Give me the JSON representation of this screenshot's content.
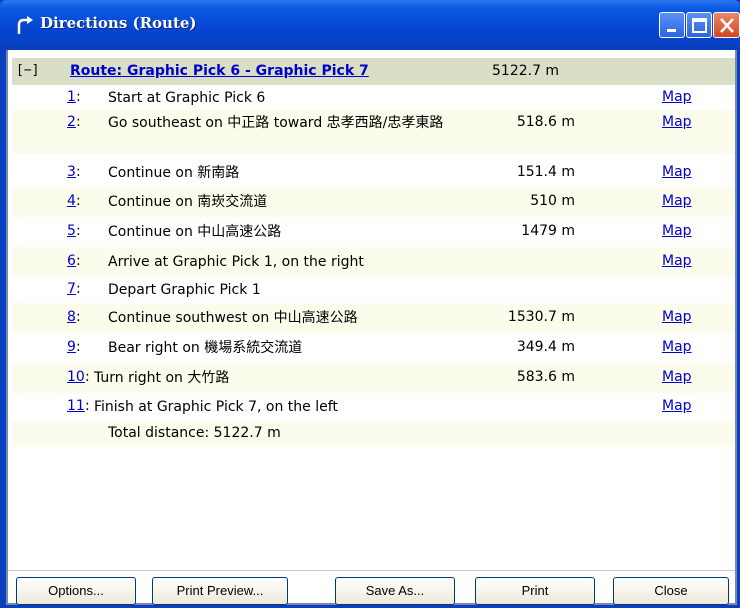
{
  "window": {
    "title": "Directions (Route)"
  },
  "route": {
    "toggle": "[−]",
    "name": "Route: Graphic Pick 6 - Graphic Pick 7",
    "distance": "5122.7 m"
  },
  "steps": [
    {
      "num": "1",
      "desc": "Start at Graphic Pick 6",
      "dist": "",
      "map": "Map"
    },
    {
      "num": "2",
      "desc": "Go southeast on 中正路 toward 忠孝西路/忠孝東路",
      "dist": "518.6 m",
      "map": "Map"
    },
    {
      "num": "3",
      "desc": "Continue on 新南路",
      "dist": "151.4 m",
      "map": "Map"
    },
    {
      "num": "4",
      "desc": "Continue on 南崁交流道",
      "dist": "510 m",
      "map": "Map"
    },
    {
      "num": "5",
      "desc": "Continue on 中山高速公路",
      "dist": "1479 m",
      "map": "Map"
    },
    {
      "num": "6",
      "desc": "Arrive at Graphic Pick 1, on the right",
      "dist": "",
      "map": "Map"
    },
    {
      "num": "7",
      "desc": "Depart Graphic Pick 1",
      "dist": "",
      "map": ""
    },
    {
      "num": "8",
      "desc": "Continue southwest on 中山高速公路",
      "dist": "1530.7 m",
      "map": "Map"
    },
    {
      "num": "9",
      "desc": "Bear right on 機場系統交流道",
      "dist": "349.4 m",
      "map": "Map"
    },
    {
      "num": "10",
      "desc": "Turn right on 大竹路",
      "dist": "583.6 m",
      "map": "Map"
    },
    {
      "num": "11",
      "desc": "Finish at Graphic Pick 7, on the left",
      "dist": "",
      "map": "Map"
    }
  ],
  "total": "Total distance: 5122.7 m",
  "buttons": {
    "options": "Options...",
    "print_preview": "Print Preview...",
    "save_as": "Save As...",
    "print": "Print",
    "close": "Close"
  },
  "colors": {
    "titlebar": "#0545d2",
    "route_row": "#d9dfc6",
    "alt_row": "#fcfcec",
    "link": "#0000cc"
  }
}
